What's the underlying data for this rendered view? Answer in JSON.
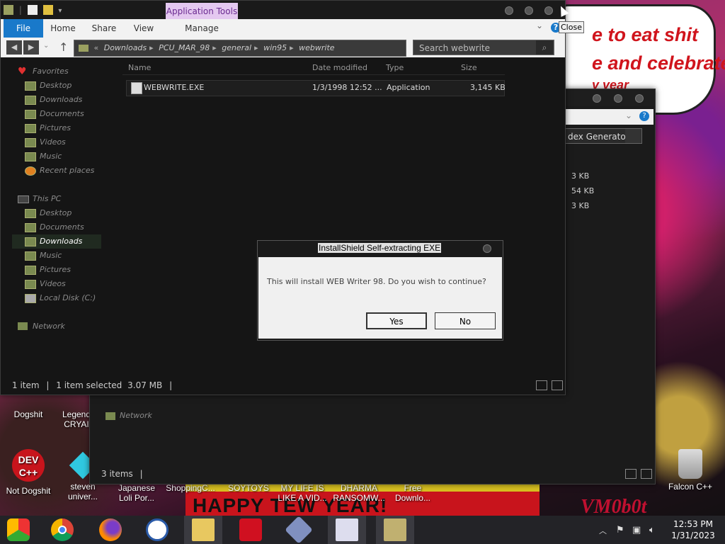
{
  "desktop": {
    "speech_lines": [
      "e to eat shit",
      "e and celebrate",
      "y year"
    ],
    "banner_text": "HAPPY TEW YEAR!",
    "corner_text": "VM0b0t",
    "icons_left": [
      {
        "label": "Dogshit"
      },
      {
        "label": "Legend CRYAI"
      }
    ],
    "icons_bottom": [
      {
        "label": "Not Dogshit"
      },
      {
        "label": "steven univer..."
      },
      {
        "label": "Japanese Loli Por..."
      },
      {
        "label": "ShoppingC..."
      },
      {
        "label": "SOYTOYS"
      },
      {
        "label": "MY LIFE IS LIKE A VID..."
      },
      {
        "label": "DHARMA RANSOMW..."
      },
      {
        "label": "Free Downlo..."
      },
      {
        "label": "Falcon C++"
      }
    ],
    "devcpp_text": "DEV C++"
  },
  "back_window": {
    "search_value": "dex Generator",
    "sizes": [
      "3 KB",
      "54 KB",
      "3 KB"
    ],
    "network_label": "Network",
    "status": "3 items"
  },
  "explorer": {
    "contextual_tab": "Application Tools",
    "ribbon_tabs": {
      "file": "File",
      "home": "Home",
      "share": "Share",
      "view": "View",
      "manage": "Manage"
    },
    "breadcrumb": [
      "Downloads",
      "PCU_MAR_98",
      "general",
      "win95",
      "webwrite"
    ],
    "search_placeholder": "Search webwrite",
    "nav": {
      "favorites": "Favorites",
      "fav_items": [
        "Desktop",
        "Downloads",
        "Documents",
        "Pictures",
        "Videos",
        "Music",
        "Recent places"
      ],
      "this_pc": "This PC",
      "pc_items": [
        "Desktop",
        "Documents",
        "Downloads",
        "Music",
        "Pictures",
        "Videos",
        "Local Disk (C:)"
      ],
      "network": "Network"
    },
    "columns": {
      "name": "Name",
      "date": "Date modified",
      "type": "Type",
      "size": "Size"
    },
    "files": [
      {
        "name": "WEBWRITE.EXE",
        "date": "1/3/1998 12:52 ...",
        "type": "Application",
        "size": "3,145 KB"
      }
    ],
    "status": {
      "count": "1 item",
      "selected": "1 item selected",
      "size": "3.07 MB"
    },
    "close_tooltip": "Close"
  },
  "dialog": {
    "title": "InstallShield Self-extracting EXE",
    "message": "This will install WEB Writer 98. Do you wish to continue?",
    "yes": "Yes",
    "no": "No"
  },
  "taskbar": {
    "time": "12:53 PM",
    "date": "1/31/2023",
    "apps": [
      "chrome-remote-icon",
      "chrome-icon",
      "firefox-icon",
      "obama-icon",
      "file-explorer-icon",
      "red-app-icon",
      "diamond-app-icon",
      "word-doc-icon",
      "installer-icon"
    ]
  }
}
